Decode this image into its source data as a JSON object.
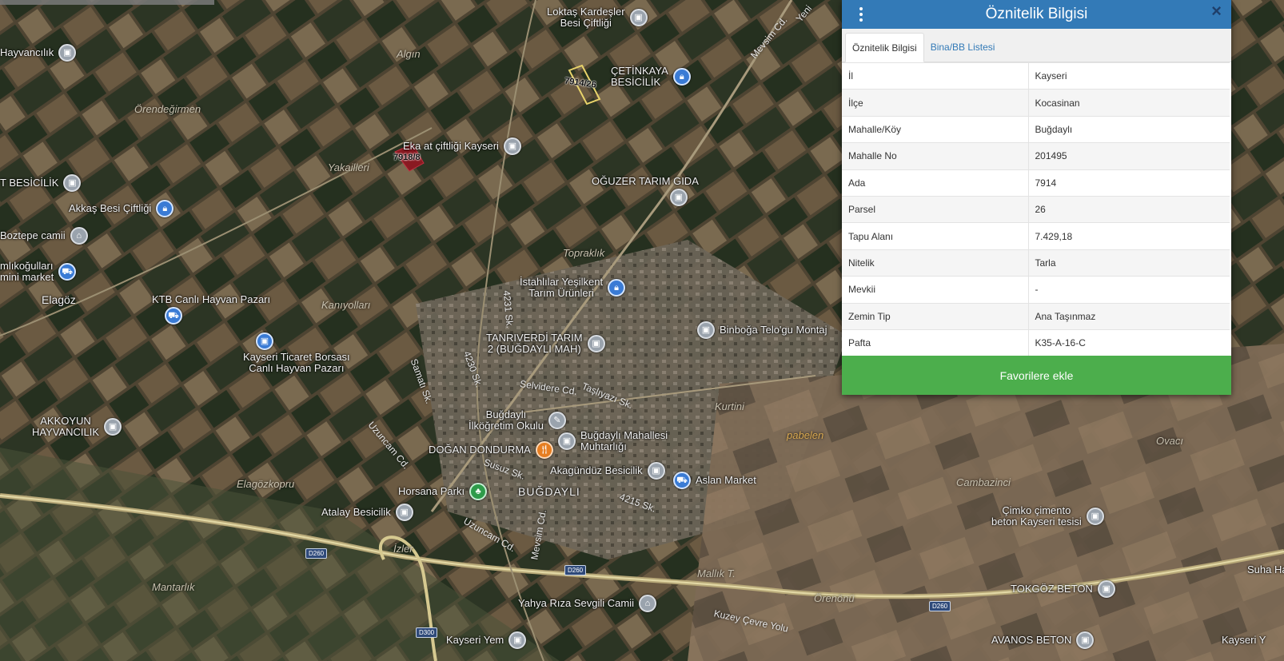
{
  "panel": {
    "title": "Öznitelik Bilgisi",
    "close_label": "×",
    "tabs": [
      {
        "label": "Öznitelik Bilgisi",
        "active": true
      },
      {
        "label": "Bina/BB Listesi",
        "active": false
      }
    ],
    "rows": [
      {
        "key": "İl",
        "value": "Kayseri"
      },
      {
        "key": "İlçe",
        "value": "Kocasinan"
      },
      {
        "key": "Mahalle/Köy",
        "value": "Buğdaylı"
      },
      {
        "key": "Mahalle No",
        "value": "201495"
      },
      {
        "key": "Ada",
        "value": "7914"
      },
      {
        "key": "Parsel",
        "value": "26"
      },
      {
        "key": "Tapu Alanı",
        "value": "7.429,18"
      },
      {
        "key": "Nitelik",
        "value": "Tarla"
      },
      {
        "key": "Mevkii",
        "value": "-"
      },
      {
        "key": "Zemin Tip",
        "value": "Ana Taşınmaz"
      },
      {
        "key": "Pafta",
        "value": "K35-A-16-C"
      }
    ],
    "favorite_button": "Favorilere ekle",
    "header_color": "#337ab7",
    "button_color": "#4cae4c"
  },
  "map": {
    "parcels": [
      "7914/26",
      "7918/8"
    ],
    "pois": [
      {
        "lines": [
          "Lоktaş Kardeşler",
          "Besi Çiftliği"
        ],
        "icon": "building-icon"
      },
      {
        "lines": [
          "ÇETİNKAYA",
          "BESİCİLİK"
        ],
        "icon": "lock-icon"
      },
      {
        "lines": [
          "Hayvancılık"
        ],
        "icon": "building-icon"
      },
      {
        "lines": [
          "Eka at çiftliği Kayseri"
        ],
        "icon": "building-icon"
      },
      {
        "lines": [
          "OĞUZER TARIM GIDA"
        ],
        "icon": "building-icon"
      },
      {
        "lines": [
          "T BESİCİLİK"
        ],
        "icon": "building-icon"
      },
      {
        "lines": [
          "Akkaş Besi Çiftliği"
        ],
        "icon": "lock-icon"
      },
      {
        "lines": [
          "Boztepe camii"
        ],
        "icon": "mosque-icon"
      },
      {
        "lines": [
          "mlıkoğulları",
          "mini market"
        ],
        "icon": "cart-icon"
      },
      {
        "lines": [
          "Elagöz"
        ],
        "icon": ""
      },
      {
        "lines": [
          "KTB Canlı Hayvan Pazarı"
        ],
        "icon": "cart-icon"
      },
      {
        "lines": [
          "İstahlılar Yeşilkent",
          "Tarım Ürünleri"
        ],
        "icon": "lock-icon"
      },
      {
        "lines": [
          "Binboğa Telo'gu Montaj"
        ],
        "icon": "building-icon"
      },
      {
        "lines": [
          "Kayseri Ticaret Borsası",
          "Canlı Hayvan Pazarı"
        ],
        "icon": "building-icon"
      },
      {
        "lines": [
          "TANRIVERDİ TARIM",
          "2 (BUĞDAYLI MAH)"
        ],
        "icon": "building-icon"
      },
      {
        "lines": [
          "AKKOYUN",
          "HAYVANCILIK"
        ],
        "icon": "building-icon"
      },
      {
        "lines": [
          "Buğdaylı",
          "İlköğretim Okulu"
        ],
        "icon": "school-icon"
      },
      {
        "lines": [
          "Buğdaylı Mahallesi",
          "Muhtarlığı"
        ],
        "icon": "building-icon"
      },
      {
        "lines": [
          "DOĞAN DONDURMA"
        ],
        "icon": "food-icon"
      },
      {
        "lines": [
          "Akagündüz Besicilik"
        ],
        "icon": "building-icon"
      },
      {
        "lines": [
          "Aslan Market"
        ],
        "icon": "cart-icon"
      },
      {
        "lines": [
          "Horsana Parkı"
        ],
        "icon": "tree-icon"
      },
      {
        "lines": [
          "BUĞDAYLI"
        ],
        "icon": ""
      },
      {
        "lines": [
          "Atalay Besicilik"
        ],
        "icon": "building-icon"
      },
      {
        "lines": [
          "Çimko çimento",
          "beton Kayseri tesisi"
        ],
        "icon": "building-icon"
      },
      {
        "lines": [
          "TOKGÖZ BETON"
        ],
        "icon": "building-icon"
      },
      {
        "lines": [
          "Yahya Rıza Sevgili Camii"
        ],
        "icon": "mosque-icon"
      },
      {
        "lines": [
          "AVANOS BETON"
        ],
        "icon": "building-icon"
      },
      {
        "lines": [
          "Kayseri Yem"
        ],
        "icon": "building-icon"
      },
      {
        "lines": [
          "Kayseri Y"
        ],
        "icon": ""
      },
      {
        "lines": [
          "Suha Ha"
        ],
        "icon": ""
      }
    ],
    "areas": [
      "Algın",
      "Örendeğirmen",
      "Yakailleri",
      "Toprаklık",
      "Kanıyolları",
      "Kurtini",
      "Elagözkopru",
      "Cambazinci",
      "Mantarlık",
      "Mallık T.",
      "Örenönü",
      "Ovacı",
      "pabelen",
      "İzler"
    ],
    "roads": [
      "Mevsim Cd.",
      "Selvidere Cd.",
      "Taşlıyazı Sk.",
      "Uzuncam Cd.",
      "Uzuncam Cd.",
      "Mevsim Cd.",
      "Kuzey Çevre Yolu",
      "Samatı Sk.",
      "Susuz Sk.",
      "4230 Sk.",
      "4231 Sk.",
      "4215 Sk.",
      "Yeni"
    ],
    "shields": [
      "D260",
      "D260",
      "D260",
      "D300"
    ]
  }
}
